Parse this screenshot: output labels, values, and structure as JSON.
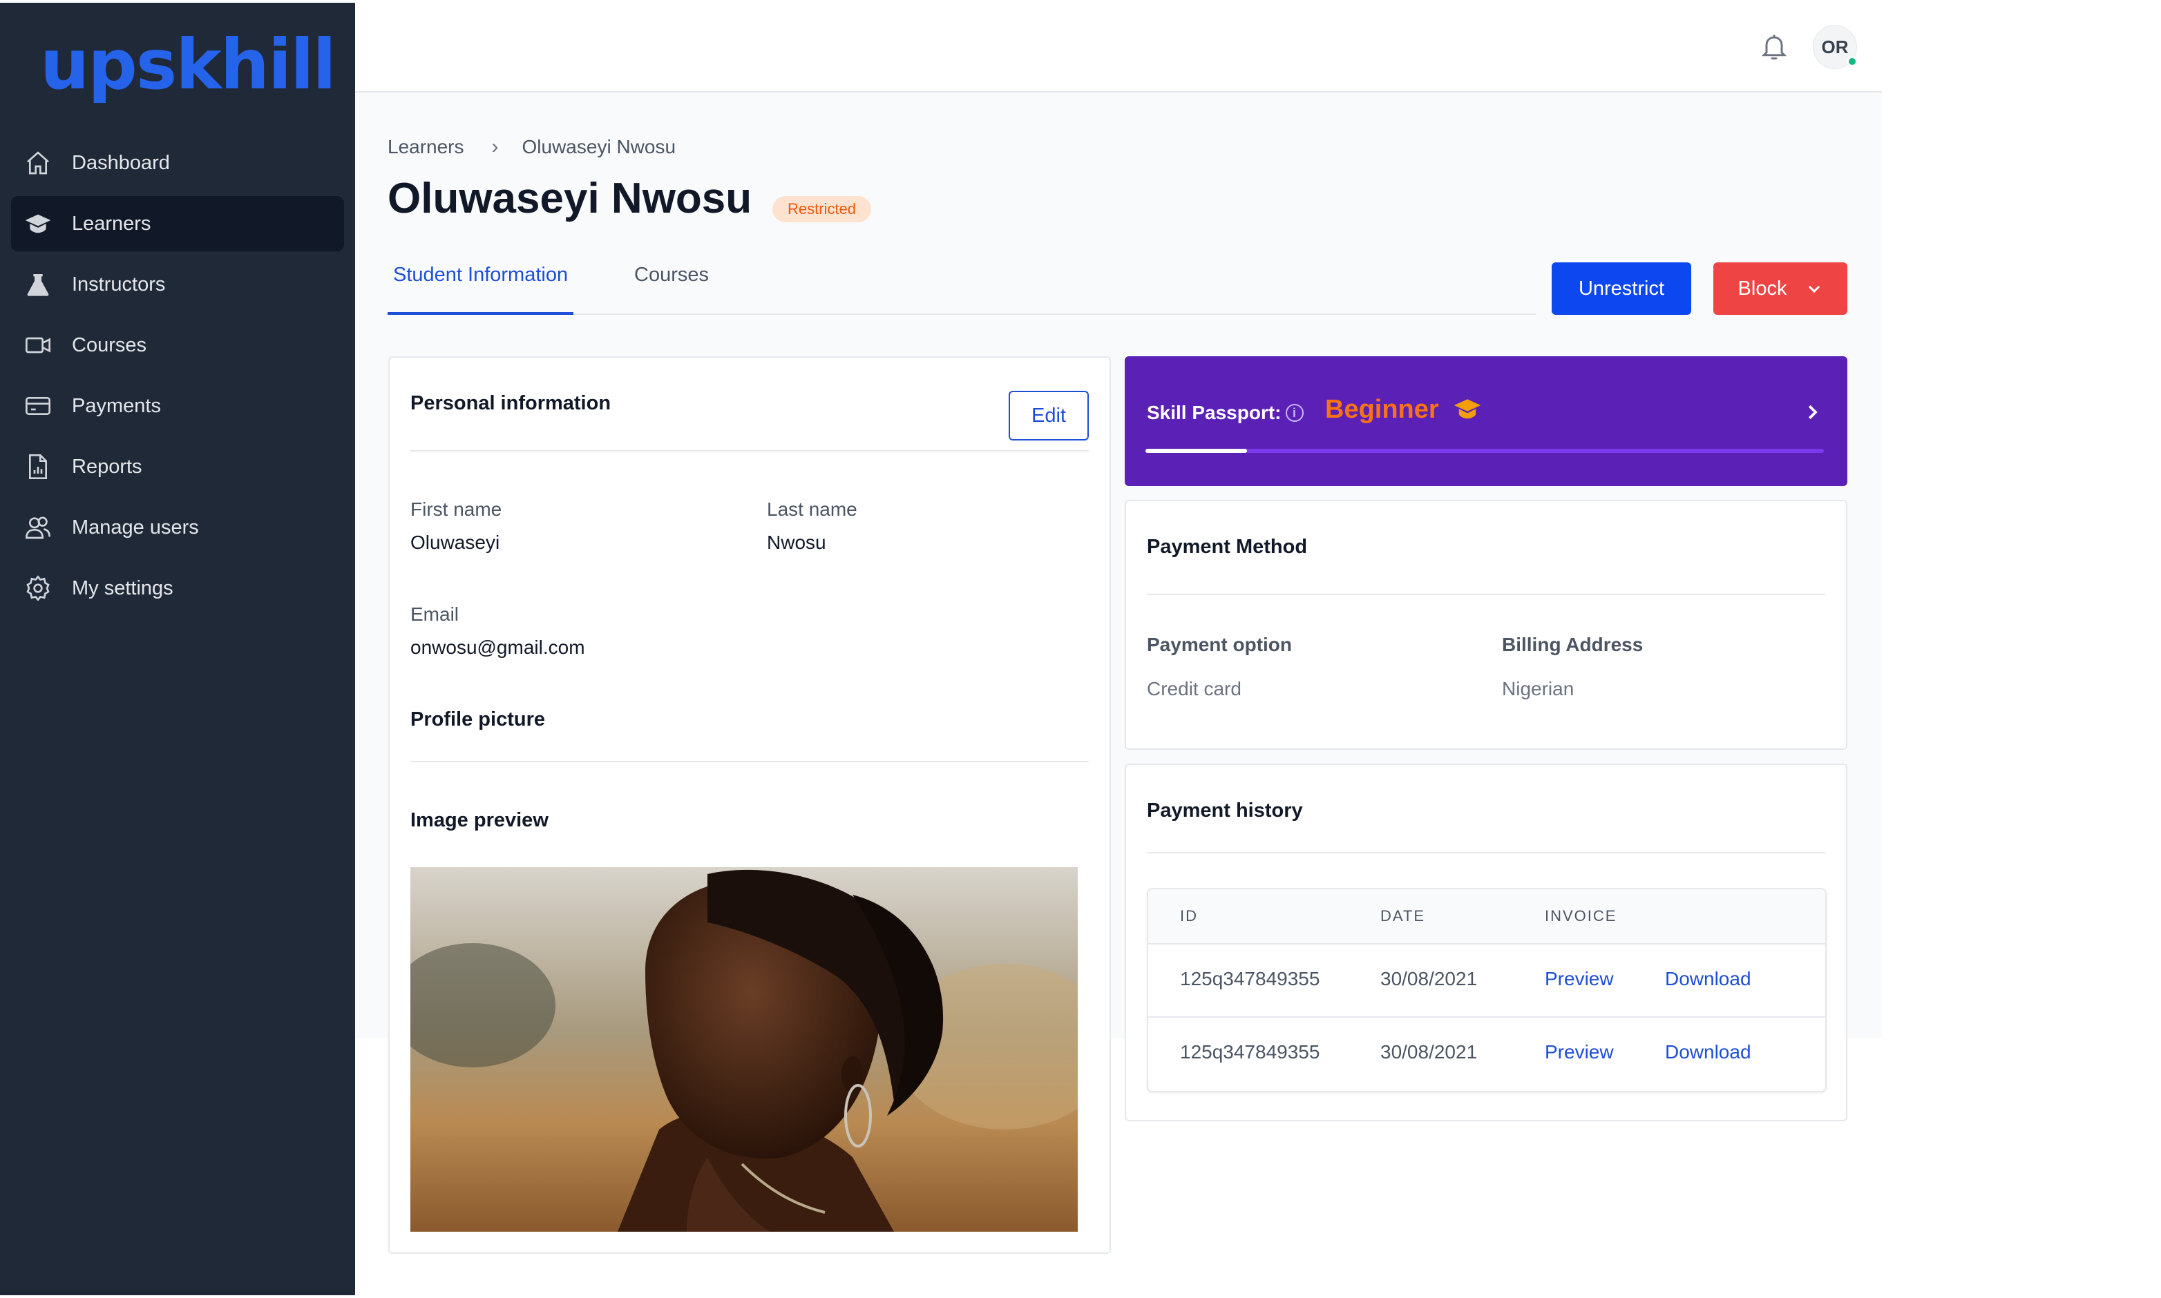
{
  "app": {
    "logo_text": "upskhill",
    "brand_color": "#2563eb"
  },
  "sidebar": {
    "items": [
      {
        "label": "Dashboard",
        "icon": "home-icon",
        "active": false
      },
      {
        "label": "Learners",
        "icon": "graduation-cap-icon",
        "active": true
      },
      {
        "label": "Instructors",
        "icon": "flask-icon",
        "active": false
      },
      {
        "label": "Courses",
        "icon": "video-camera-icon",
        "active": false
      },
      {
        "label": "Payments",
        "icon": "credit-card-icon",
        "active": false
      },
      {
        "label": "Reports",
        "icon": "report-document-icon",
        "active": false
      },
      {
        "label": "Manage users",
        "icon": "users-icon",
        "active": false
      },
      {
        "label": "My settings",
        "icon": "gear-icon",
        "active": false
      }
    ]
  },
  "topbar": {
    "avatar_initials": "OR",
    "notification_icon": "bell-icon",
    "online_status_color": "#10b981"
  },
  "breadcrumb": {
    "parent": "Learners",
    "current": "Oluwaseyi Nwosu"
  },
  "page": {
    "title": "Oluwaseyi Nwosu",
    "status_badge": "Restricted"
  },
  "tabs": [
    {
      "label": "Student Information",
      "active": true
    },
    {
      "label": "Courses",
      "active": false
    }
  ],
  "actions": {
    "unrestrict_label": "Unrestrict",
    "block_label": "Block"
  },
  "personal": {
    "heading": "Personal information",
    "edit_label": "Edit",
    "first_name_label": "First name",
    "first_name": "Oluwaseyi",
    "last_name_label": "Last name",
    "last_name": "Nwosu",
    "email_label": "Email",
    "email": "onwosu@gmail.com",
    "profile_picture_heading": "Profile picture",
    "image_preview_heading": "Image preview"
  },
  "skill_passport": {
    "label": "Skill Passport:",
    "level": "Beginner",
    "progress_percent": 15
  },
  "payment_method": {
    "heading": "Payment Method",
    "option_label": "Payment option",
    "option_value": "Credit card",
    "billing_label": "Billing Address",
    "billing_value": "Nigerian"
  },
  "payment_history": {
    "heading": "Payment history",
    "columns": [
      "ID",
      "DATE",
      "INVOICE"
    ],
    "rows": [
      {
        "id": "125q347849355",
        "date": "30/08/2021",
        "preview": "Preview",
        "download": "Download"
      },
      {
        "id": "125q347849355",
        "date": "30/08/2021",
        "preview": "Preview",
        "download": "Download"
      }
    ]
  }
}
